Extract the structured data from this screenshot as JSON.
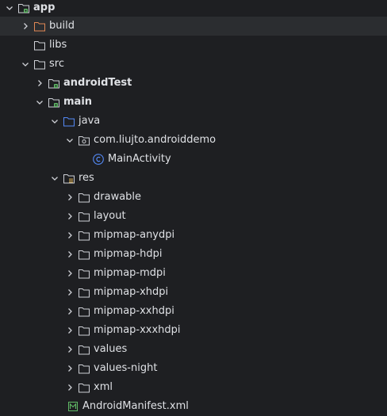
{
  "tree": {
    "items": [
      {
        "label": "app",
        "expanded": true,
        "icon": "module-folder-icon",
        "bold": true
      },
      {
        "label": "build",
        "expanded": false,
        "icon": "excluded-folder-icon",
        "bold": false,
        "selected": true
      },
      {
        "label": "libs",
        "expanded": null,
        "icon": "folder-icon",
        "bold": false
      },
      {
        "label": "src",
        "expanded": true,
        "icon": "folder-icon",
        "bold": false
      },
      {
        "label": "androidTest",
        "expanded": false,
        "icon": "module-folder-icon",
        "bold": true
      },
      {
        "label": "main",
        "expanded": true,
        "icon": "module-folder-icon",
        "bold": true
      },
      {
        "label": "java",
        "expanded": true,
        "icon": "source-folder-icon",
        "bold": false
      },
      {
        "label": "com.liujto.androiddemo",
        "expanded": true,
        "icon": "package-icon",
        "bold": false
      },
      {
        "label": "MainActivity",
        "expanded": null,
        "icon": "class-icon",
        "bold": false
      },
      {
        "label": "res",
        "expanded": true,
        "icon": "resource-folder-icon",
        "bold": false
      },
      {
        "label": "drawable",
        "expanded": false,
        "icon": "folder-icon",
        "bold": false
      },
      {
        "label": "layout",
        "expanded": false,
        "icon": "folder-icon",
        "bold": false
      },
      {
        "label": "mipmap-anydpi",
        "expanded": false,
        "icon": "folder-icon",
        "bold": false
      },
      {
        "label": "mipmap-hdpi",
        "expanded": false,
        "icon": "folder-icon",
        "bold": false
      },
      {
        "label": "mipmap-mdpi",
        "expanded": false,
        "icon": "folder-icon",
        "bold": false
      },
      {
        "label": "mipmap-xhdpi",
        "expanded": false,
        "icon": "folder-icon",
        "bold": false
      },
      {
        "label": "mipmap-xxhdpi",
        "expanded": false,
        "icon": "folder-icon",
        "bold": false
      },
      {
        "label": "mipmap-xxxhdpi",
        "expanded": false,
        "icon": "folder-icon",
        "bold": false
      },
      {
        "label": "values",
        "expanded": false,
        "icon": "folder-icon",
        "bold": false
      },
      {
        "label": "values-night",
        "expanded": false,
        "icon": "folder-icon",
        "bold": false
      },
      {
        "label": "xml",
        "expanded": false,
        "icon": "folder-icon",
        "bold": false
      },
      {
        "label": "AndroidManifest.xml",
        "expanded": null,
        "icon": "manifest-file-icon",
        "bold": false
      }
    ]
  },
  "colors": {
    "background": "#1e1f22",
    "selected_row": "#2b2d30",
    "text": "#dfe1e5",
    "folder_stroke": "#ced0d6",
    "excluded_folder": "#e08855",
    "module_badge": "#5fb865",
    "source_folder": "#548af7",
    "class_icon": "#548af7",
    "manifest_icon": "#5fb865",
    "resource_lines": "#e0b252"
  }
}
